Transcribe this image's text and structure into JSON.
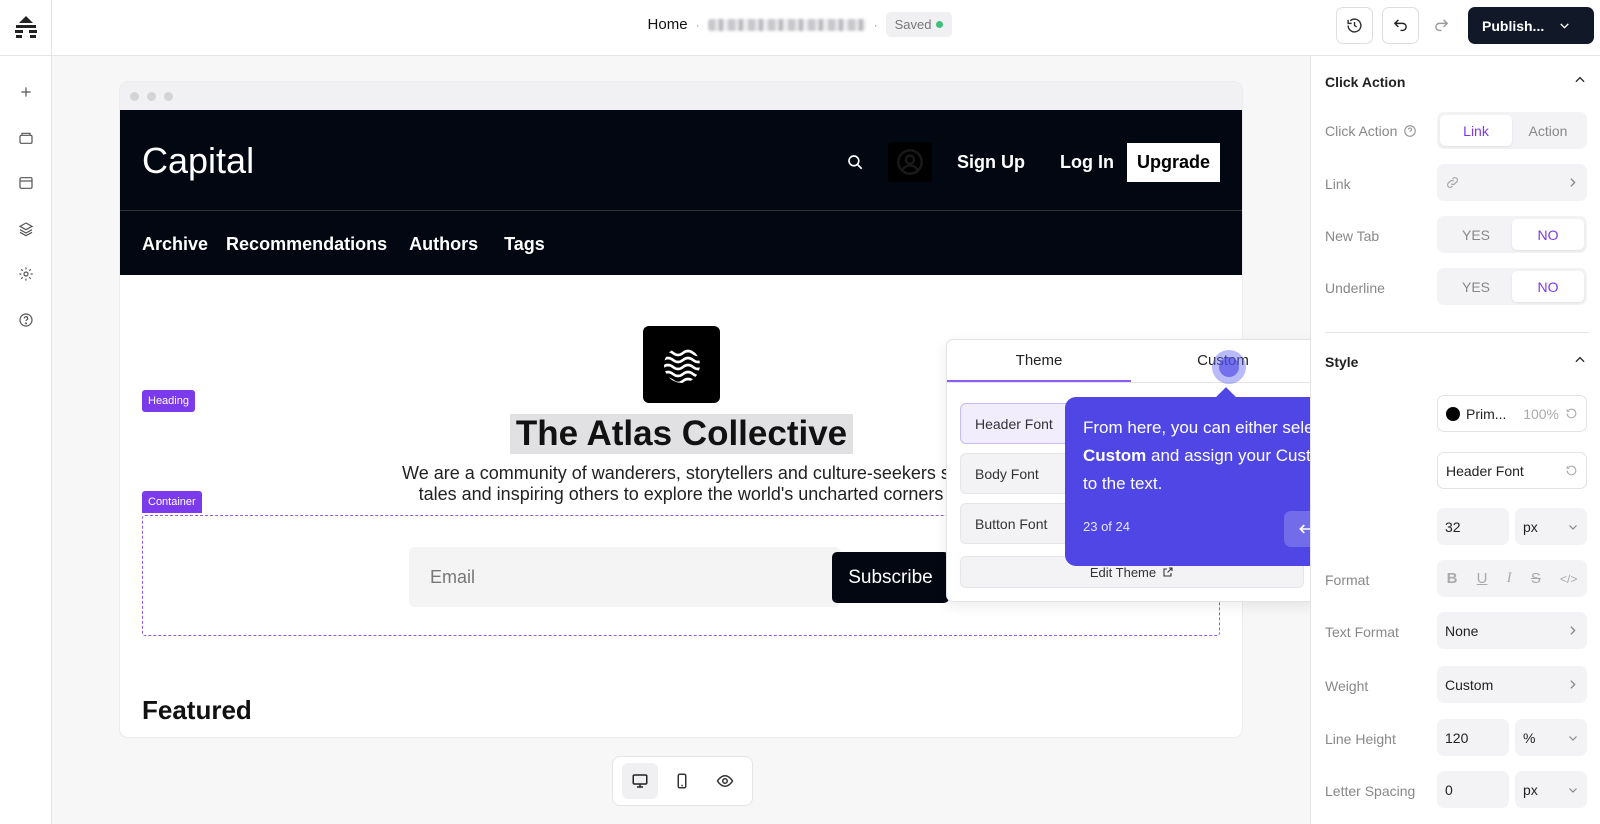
{
  "topbar": {
    "page_name": "Home",
    "separator": "·",
    "status": "Saved",
    "publish_label": "Publish..."
  },
  "site": {
    "logo_text": "Capital",
    "actions": [
      "Sign Up",
      "Log In"
    ],
    "upgrade_label": "Upgrade",
    "nav": [
      "Archive",
      "Recommendations",
      "Authors",
      "Tags"
    ]
  },
  "canvas": {
    "heading_tag": "Heading",
    "container_tag": "Container",
    "title": "The Atlas Collective",
    "description_line1": "We are a community of wanderers, storytellers and culture-seekers sh",
    "description_line2": "tales and inspiring others to explore the world's uncharted corners",
    "email_placeholder": "Email",
    "subscribe_label": "Subscribe",
    "featured_label": "Featured"
  },
  "font_popover": {
    "tabs": [
      "Theme",
      "Custom"
    ],
    "active_tab": "Theme",
    "items": [
      "Header Font",
      "Body Font",
      "Button Font"
    ],
    "selected": "Header Font",
    "edit_theme_label": "Edit Theme"
  },
  "tour": {
    "text_before": "From here, you can either select ",
    "text_bold": "Custom",
    "text_after": " and assign your Custom font to the text.",
    "step": "23 of 24"
  },
  "right_panel": {
    "click_action": {
      "title": "Click Action",
      "label": "Click Action",
      "options": [
        "Link",
        "Action"
      ],
      "selected": "Link",
      "link_label": "Link",
      "new_tab_label": "New Tab",
      "new_tab_options": [
        "YES",
        "NO"
      ],
      "new_tab_selected": "NO",
      "underline_label": "Underline",
      "underline_options": [
        "YES",
        "NO"
      ],
      "underline_selected": "NO"
    },
    "style": {
      "title": "Style",
      "color_name": "Prim...",
      "color_opacity": "100%",
      "color_hex": "#000000",
      "font_value": "Header Font",
      "size_value": "32",
      "size_unit": "px",
      "format_label": "Format",
      "format_icons": [
        "B",
        "U",
        "I",
        "S",
        "</>"
      ],
      "text_format_label": "Text Format",
      "text_format_value": "None",
      "weight_label": "Weight",
      "weight_value": "Custom",
      "line_height_label": "Line Height",
      "line_height_value": "120",
      "line_height_unit": "%",
      "letter_spacing_label": "Letter Spacing",
      "letter_spacing_value": "0",
      "letter_spacing_unit": "px"
    }
  },
  "colors": {
    "accent": "#7c3aed",
    "tour": "#4f46e5",
    "site_header": "#030712",
    "publish": "#111827",
    "saved_dot": "#3cc07a"
  }
}
